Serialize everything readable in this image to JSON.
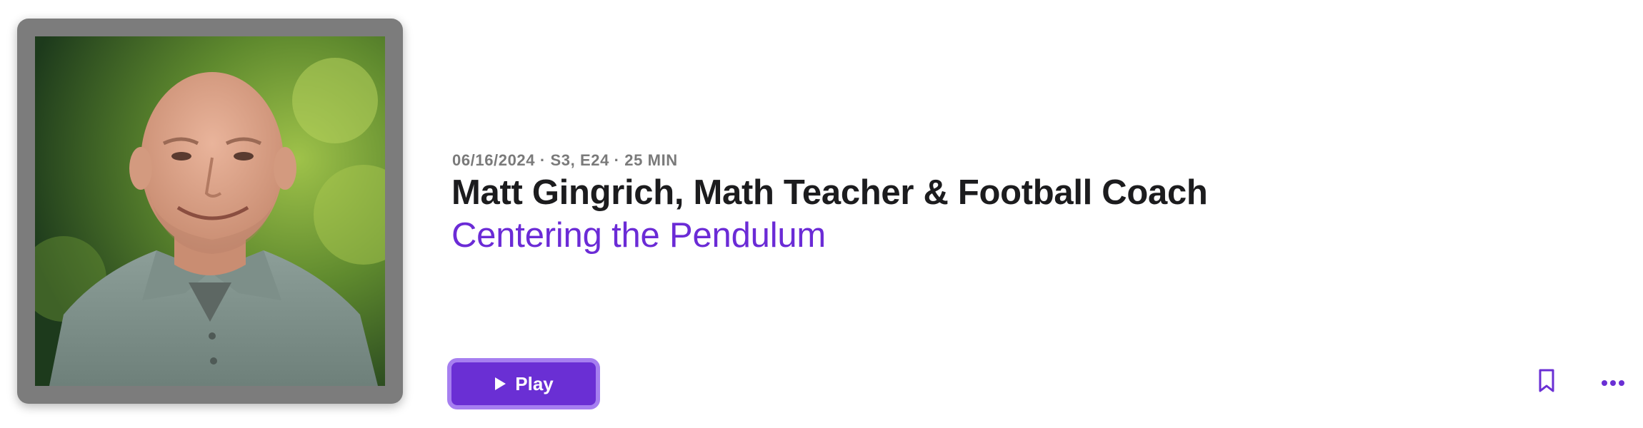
{
  "episode": {
    "meta": "06/16/2024 · S3, E24 · 25 MIN",
    "title": "Matt Gingrich, Math Teacher & Football Coach",
    "show_title": "Centering the Pendulum"
  },
  "artwork": {
    "alt": "Episode artwork"
  },
  "actions": {
    "play_label": "Play",
    "play_icon": "play-icon",
    "bookmark_icon": "bookmark-icon",
    "more_icon": "more-horizontal-icon"
  },
  "colors": {
    "accent": "#6a2fd4",
    "accent_border": "#a67ff0",
    "show_title": "#6b2bd6",
    "title": "#1c1c1e",
    "meta": "#7a7a7a",
    "artwork_frame": "#7c7c7c"
  }
}
